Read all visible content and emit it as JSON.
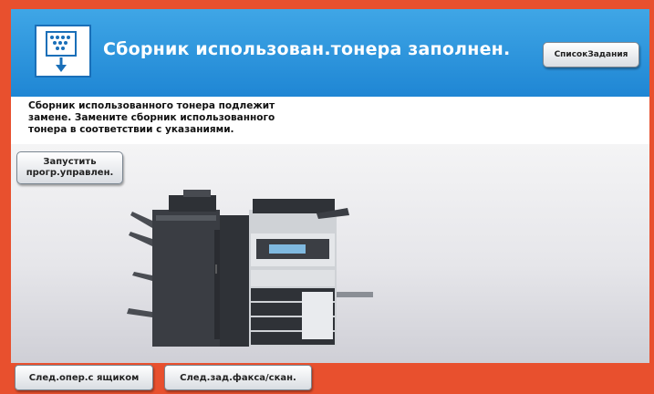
{
  "header": {
    "title": "Сборник использован.тонера заполнен.",
    "job_list_label": "СписокЗадания",
    "icon": "toner-waste-box-icon"
  },
  "message": {
    "lines": [
      "Сборник использованного тонера подлежит",
      "замене. Замените сборник использованного",
      "тонера в соответствии с указаниями."
    ]
  },
  "launch_button": {
    "line1": "Запустить",
    "line2": "прогр.управлен."
  },
  "illustration": {
    "icon": "multifunction-printer-icon"
  },
  "bottom": {
    "box_ops_label": "След.опер.с ящиком",
    "fax_scan_label": "След.зад.факса/скан."
  },
  "colors": {
    "frame": "#e8502e",
    "header": "#2a92dc",
    "button": "#e6e9ec"
  }
}
